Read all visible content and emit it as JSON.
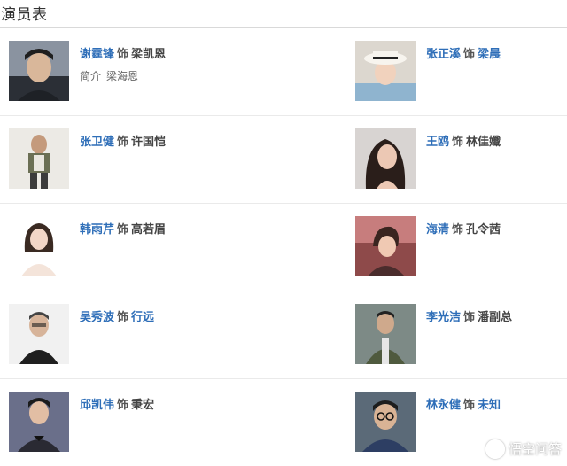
{
  "header": {
    "title": "演员表"
  },
  "connector": "饰",
  "intro_label": "简介",
  "cast": [
    {
      "actor": "谢霆锋",
      "role": "梁凯恩",
      "role_link": false,
      "intro_name": "梁海恩"
    },
    {
      "actor": "张正溪",
      "role": "梁晨",
      "role_link": true
    },
    {
      "actor": "张卫健",
      "role": "许国恺",
      "role_link": false
    },
    {
      "actor": "王鸥",
      "role": "林佳孅",
      "role_link": false
    },
    {
      "actor": "韩雨芹",
      "role": "高若眉",
      "role_link": false
    },
    {
      "actor": "海清",
      "role": "孔令茜",
      "role_link": false
    },
    {
      "actor": "吴秀波",
      "role": "行远",
      "role_link": true
    },
    {
      "actor": "李光洁",
      "role": "潘副总",
      "role_link": false
    },
    {
      "actor": "邱凯伟",
      "role": "秉宏",
      "role_link": false
    },
    {
      "actor": "林永健",
      "role": "未知",
      "role_link": true
    }
  ],
  "watermark": "悟空问答",
  "colors": {
    "link": "#2e6eb8",
    "text": "#444444",
    "divider": "#eaeaea"
  }
}
